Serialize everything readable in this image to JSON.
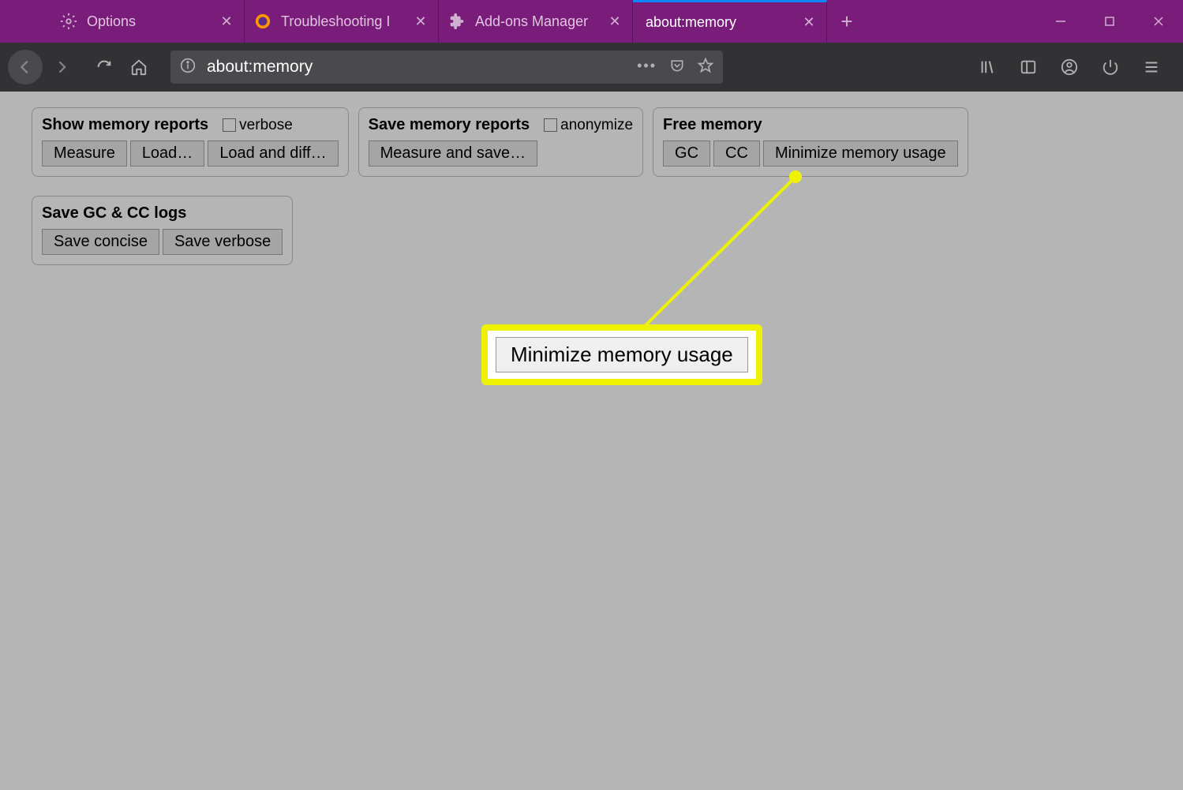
{
  "tabs": [
    {
      "label": "Options",
      "icon": "gear"
    },
    {
      "label": "Troubleshooting I",
      "icon": "firefox"
    },
    {
      "label": "Add-ons Manager",
      "icon": "puzzle"
    },
    {
      "label": "about:memory",
      "icon": "",
      "active": true
    }
  ],
  "url": "about:memory",
  "panels": {
    "show_reports": {
      "title": "Show memory reports",
      "checkbox": "verbose",
      "buttons": {
        "measure": "Measure",
        "load": "Load…",
        "load_diff": "Load and diff…"
      }
    },
    "save_reports": {
      "title": "Save memory reports",
      "checkbox": "anonymize",
      "buttons": {
        "measure_save": "Measure and save…"
      }
    },
    "free_memory": {
      "title": "Free memory",
      "buttons": {
        "gc": "GC",
        "cc": "CC",
        "minimize": "Minimize memory usage"
      }
    },
    "save_logs": {
      "title": "Save GC & CC logs",
      "buttons": {
        "concise": "Save concise",
        "verbose": "Save verbose"
      }
    }
  },
  "callout": {
    "label": "Minimize memory usage"
  }
}
